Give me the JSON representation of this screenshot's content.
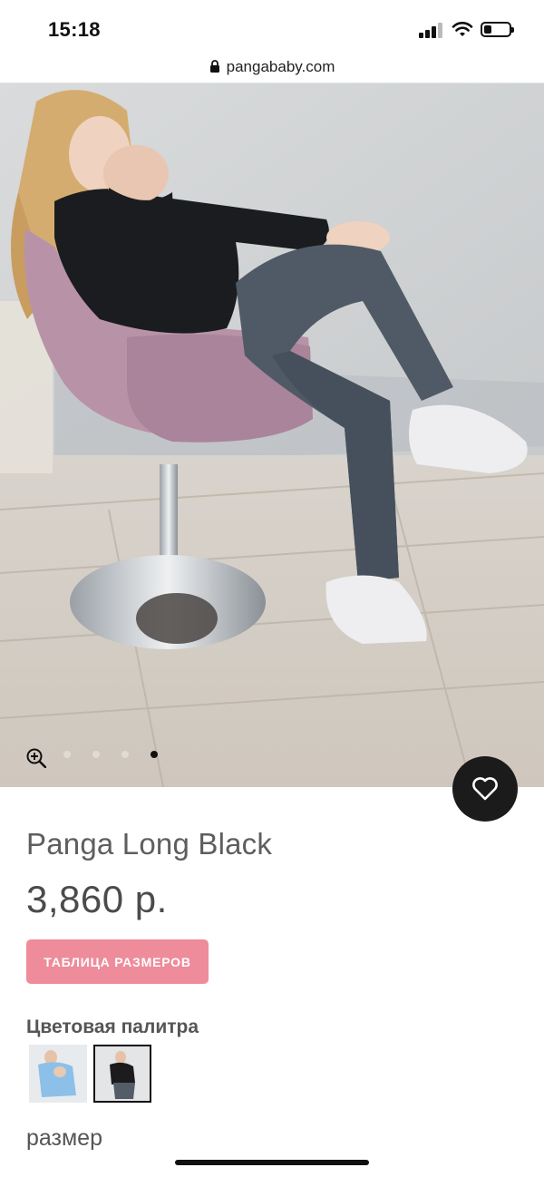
{
  "status_bar": {
    "time": "15:18"
  },
  "browser": {
    "url": "pangababy.com"
  },
  "hero": {
    "image_alt": "product photo",
    "dots_count": 4,
    "active_dot": 3
  },
  "product": {
    "title": "Panga Long Black",
    "price": "3,860 р.",
    "size_chart_label": "ТАБЛИЦА РАЗМЕРОВ",
    "palette_label": "Цветовая палитра",
    "size_label": "размер"
  },
  "colors": {
    "accent_pink": "#ee8c9b",
    "fav_button_bg": "#1b1b1b",
    "text_gray": "#5e5e5e"
  },
  "icons": {
    "zoom": "zoom-in-icon",
    "favorite": "heart-icon",
    "lock": "lock-icon"
  }
}
